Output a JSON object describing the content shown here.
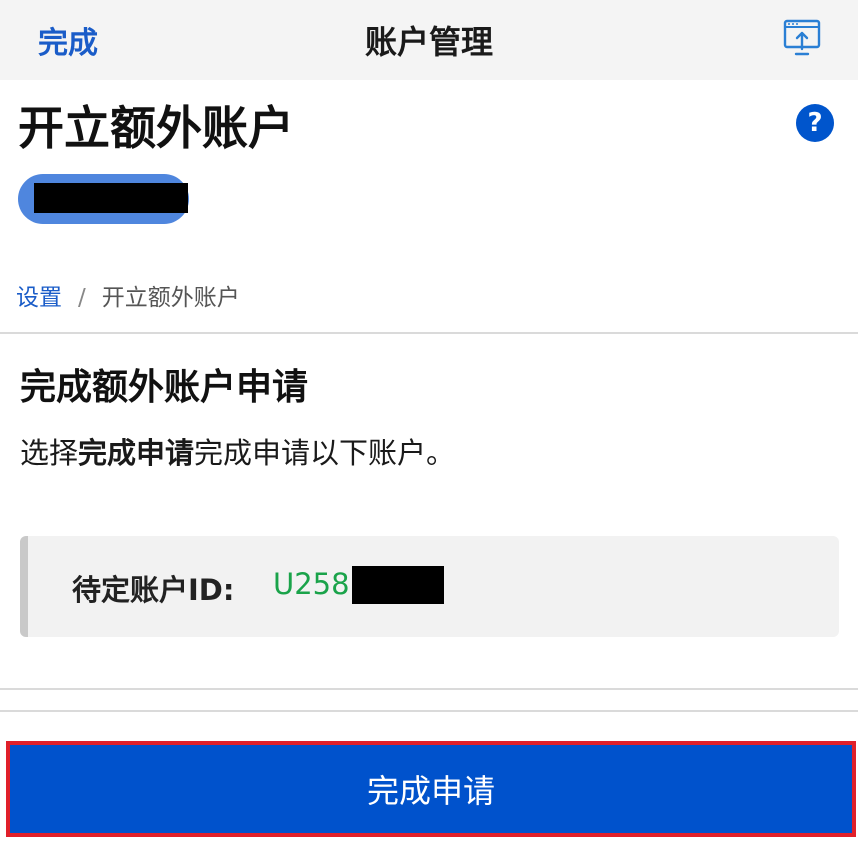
{
  "navbar": {
    "done_label": "完成",
    "title": "账户管理",
    "share_icon": "share-screen-icon"
  },
  "header": {
    "title": "开立额外账户",
    "help_icon_label": "?"
  },
  "breadcrumb": {
    "items": [
      {
        "label": "设置",
        "link": true
      },
      {
        "label": "开立额外账户",
        "link": false
      }
    ],
    "separator": "/"
  },
  "section": {
    "title": "完成额外账户申请",
    "desc_prefix": "选择",
    "desc_bold": "完成申请",
    "desc_suffix": "完成申请以下账户。"
  },
  "pending_account": {
    "label": "待定账户ID:",
    "value_visible": "U258"
  },
  "actions": {
    "submit_label": "完成申请"
  },
  "colors": {
    "primary": "#0052cc",
    "link": "#1a5cc8",
    "success": "#1aa34a",
    "highlight_border": "#e0202a"
  }
}
